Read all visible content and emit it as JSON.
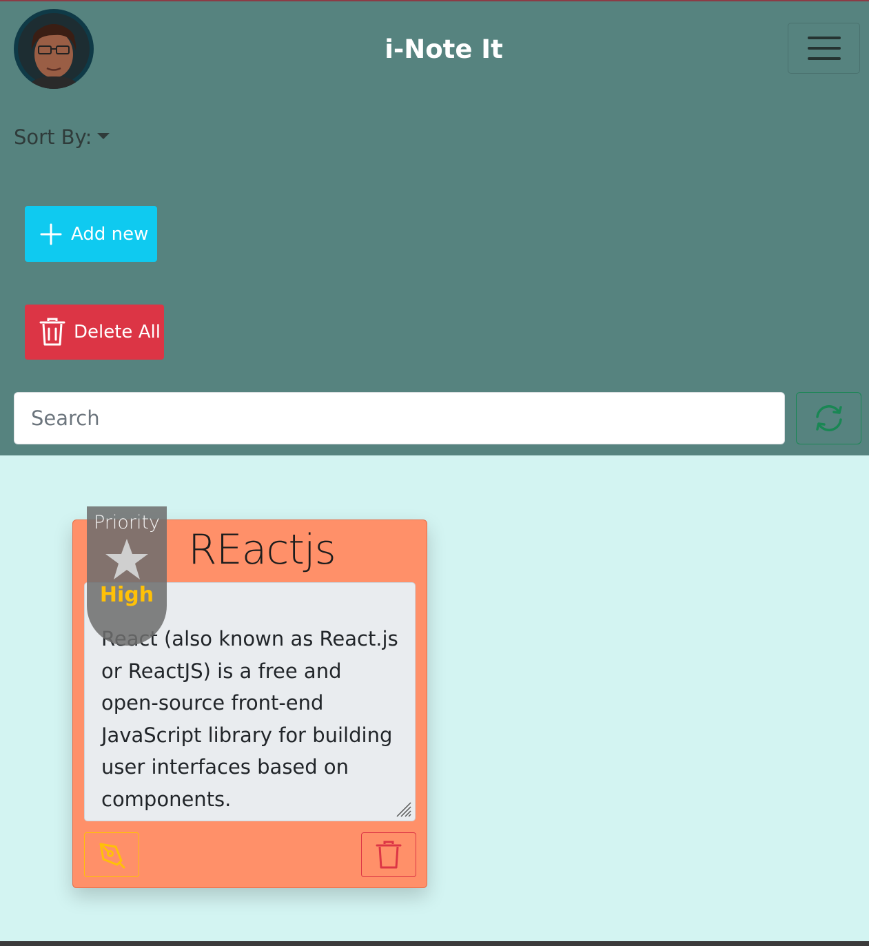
{
  "header": {
    "app_title": "i-Note It",
    "sort_label": "Sort By:",
    "add_label": "Add new",
    "delete_all_label": "Delete All",
    "search_placeholder": "Search",
    "icons": [
      "avatar",
      "hamburger-menu-icon",
      "plus-icon",
      "trash-icon",
      "refresh-icon"
    ]
  },
  "note": {
    "title": "REactjs",
    "body": "React (also known as React.js or ReactJS) is a free and open-source front-end JavaScript library for building user interfaces based on components.",
    "priority_label": "Priority",
    "priority_level": "High",
    "color": "#ff9069"
  },
  "colors": {
    "header_bg": "#56837f",
    "page_bg": "#d3f4f2",
    "info": "#0fcaf0",
    "danger": "#dc3545",
    "success": "#198754",
    "warning": "#ffc107"
  }
}
